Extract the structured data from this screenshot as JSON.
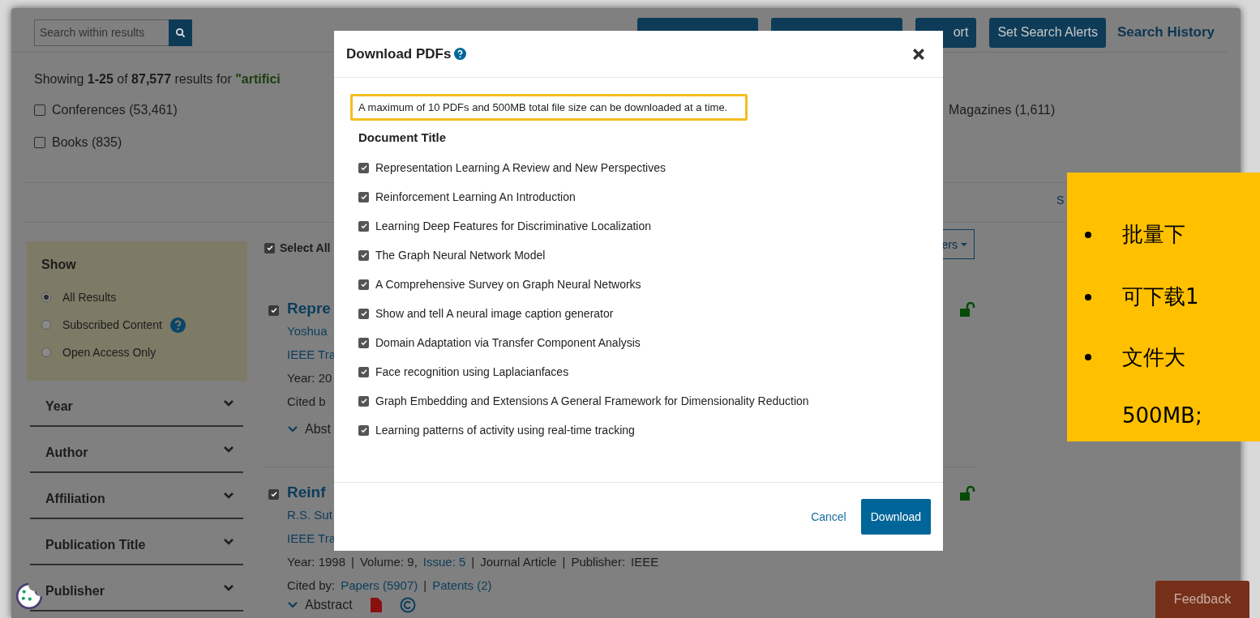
{
  "search": {
    "placeholder": "Search within results"
  },
  "toolbar": {
    "buttons": [
      {
        "kind": "button"
      },
      {
        "kind": "button"
      },
      {
        "label": "ort",
        "kind": "button"
      },
      {
        "label": "Set Search Alerts",
        "kind": "button"
      },
      {
        "label": "Search History",
        "kind": "link"
      }
    ]
  },
  "summary": {
    "prefix": "Showing",
    "range": "1-25",
    "of": "of",
    "total": "87,577",
    "suffix": "results for",
    "query": "\"artifici"
  },
  "filters": [
    {
      "label": "Conferences (53,461)",
      "checked": false
    },
    {
      "label": "Magazines (1,611)"
    },
    {
      "label": "Books (835)",
      "checked": false
    }
  ],
  "show_more": "S",
  "sidebar": {
    "show": {
      "title": "Show",
      "options": [
        {
          "label": "All Results",
          "selected": true,
          "help": false
        },
        {
          "label": "Subscribed Content",
          "selected": false,
          "help": true
        },
        {
          "label": "Open Access Only",
          "selected": false,
          "help": false
        }
      ]
    },
    "sections": [
      {
        "label": "Year",
        "expanded": false
      },
      {
        "label": "Author",
        "expanded": false
      },
      {
        "label": "Affiliation",
        "expanded": false
      },
      {
        "label": "Publication Title",
        "expanded": false
      },
      {
        "label": "Publisher",
        "expanded": false
      }
    ]
  },
  "select_all": {
    "label": "Select All",
    "checked": true
  },
  "sort_button": "ers",
  "results": [
    {
      "checked": true,
      "title": "Repre",
      "authors": "Yoshua",
      "venue": "IEEE Tra",
      "meta": [
        {
          "text": "Year: 20",
          "link": false
        }
      ],
      "cited": [
        {
          "text": "Cited b",
          "link": false
        }
      ],
      "abstract": "Abst",
      "icons": false
    },
    {
      "checked": true,
      "title": "Reinf",
      "authors": "R.S. Sut",
      "venue": "IEEE Tra",
      "meta": [
        {
          "text": "Year: 1998",
          "link": false
        },
        {
          "text": "|",
          "link": false
        },
        {
          "text": "Volume: 9,",
          "link": false
        },
        {
          "text": "Issue: 5",
          "link": true
        },
        {
          "text": "|",
          "link": false
        },
        {
          "text": "Journal Article",
          "link": false
        },
        {
          "text": "|",
          "link": false
        },
        {
          "text": "Publisher:",
          "link": false
        },
        {
          "text": "IEEE",
          "link": false
        }
      ],
      "cited": [
        {
          "text": "Cited by:",
          "link": false
        },
        {
          "text": "Papers (5907)",
          "link": true
        },
        {
          "text": "|",
          "link": false
        },
        {
          "text": "Patents (2)",
          "link": true
        }
      ],
      "abstract": "Abstract",
      "icons": true
    }
  ],
  "modal": {
    "title": "Download PDFs",
    "notice": "A maximum of 10 PDFs and 500MB total file size can be downloaded at a time.",
    "column": "Document Title",
    "items": [
      {
        "title": "Representation Learning A Review and New Perspectives",
        "checked": true
      },
      {
        "title": "Reinforcement Learning An Introduction",
        "checked": true
      },
      {
        "title": "Learning Deep Features for Discriminative Localization",
        "checked": true
      },
      {
        "title": "The Graph Neural Network Model",
        "checked": true
      },
      {
        "title": "A Comprehensive Survey on Graph Neural Networks",
        "checked": true
      },
      {
        "title": "Show and tell A neural image caption generator",
        "checked": true
      },
      {
        "title": "Domain Adaptation via Transfer Component Analysis",
        "checked": true
      },
      {
        "title": "Face recognition using Laplacianfaces",
        "checked": true
      },
      {
        "title": "Graph Embedding and Extensions A General Framework for Dimensionality Reduction",
        "checked": true
      },
      {
        "title": "Learning patterns of activity using real-time tracking",
        "checked": true
      }
    ],
    "cancel": "Cancel",
    "download": "Download"
  },
  "callout": [
    "批量下",
    "可下载1",
    "文件大",
    "500MB;"
  ],
  "feedback": "Feedback"
}
